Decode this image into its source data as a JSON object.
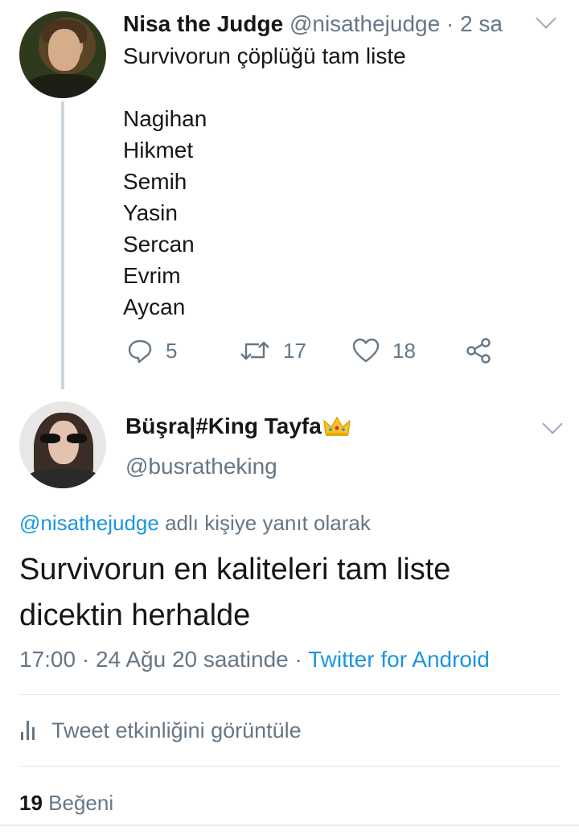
{
  "parent_tweet": {
    "author_name": "Nisa the Judge",
    "author_handle": "@nisathejudge",
    "separator": " · ",
    "time": "2 sa",
    "text_title": "Survivorun çöplüğü tam liste",
    "list": [
      "Nagihan",
      "Hikmet",
      "Semih",
      "Yasin",
      "Sercan",
      "Evrim",
      "Aycan"
    ],
    "actions": {
      "reply_icon": "reply-icon",
      "reply_count": "5",
      "retweet_icon": "retweet-icon",
      "retweet_count": "17",
      "like_icon": "heart-icon",
      "like_count": "18",
      "share_icon": "share-icon"
    }
  },
  "focused_tweet": {
    "author_name": "Büşra|#King Tayfa",
    "author_emoji": "crown-icon",
    "author_handle": "@busratheking",
    "reply_to_handle": "@nisathejudge",
    "reply_to_suffix": " adlı kişiye yanıt olarak",
    "text_line1": "Survivorun en kaliteleri tam liste",
    "text_line2": "dicektin herhalde",
    "time": "17:00",
    "date": "24 Ağu 20 saatinde",
    "sep": " · ",
    "source": "Twitter for Android",
    "activity_label": "Tweet etkinliğini görüntüle",
    "likes_count": "19",
    "likes_label": "Beğeni"
  },
  "colors": {
    "link": "#1b95e0",
    "secondary_text": "#657786",
    "primary_text": "#14171a",
    "divider": "#e1e8ed"
  }
}
